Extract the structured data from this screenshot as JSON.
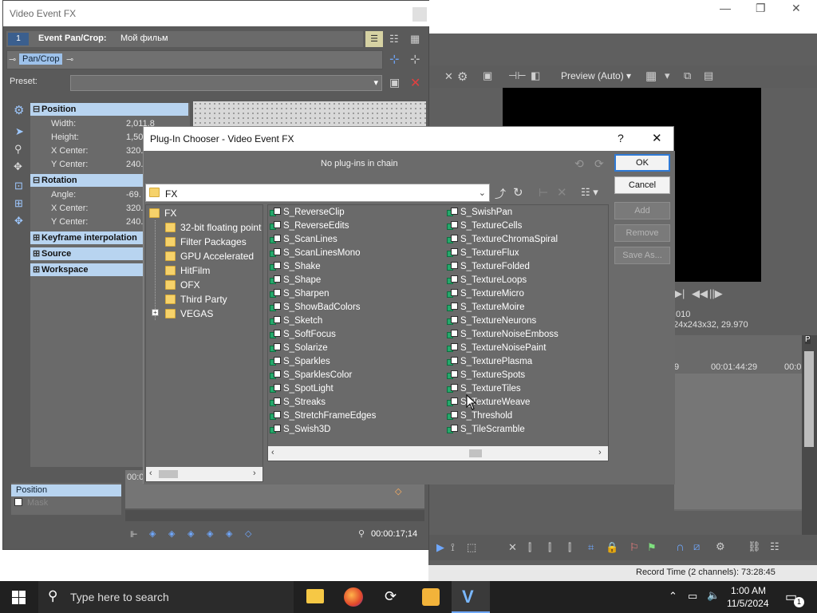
{
  "main_window": {
    "minimize": "—",
    "restore": "❐",
    "close": "✕",
    "preview_mode": "Preview (Auto)",
    "video_info_1": ",010",
    "video_info_2": "24x243x32, 29.970",
    "timecode_1": "9",
    "timecode_2": "00:01:44:29",
    "timecode_3": "00:0",
    "record_time": "Record Time (2 channels): 73:28:45"
  },
  "vfx": {
    "title": "Video Event FX",
    "chain_number": "1",
    "event_label": "Event Pan/Crop:",
    "event_name": "Мой фильм",
    "chain_plugin": "Pan/Crop",
    "preset_label": "Preset:",
    "position_header": "Position",
    "position_rows": [
      {
        "label": "Width:",
        "value": "2,011.8"
      },
      {
        "label": "Height:",
        "value": "1,50"
      },
      {
        "label": "X Center:",
        "value": "320."
      },
      {
        "label": "Y Center:",
        "value": "240."
      }
    ],
    "rotation_header": "Rotation",
    "rotation_rows": [
      {
        "label": "Angle:",
        "value": "-69."
      },
      {
        "label": "X Center:",
        "value": "320."
      },
      {
        "label": "Y Center:",
        "value": "240."
      }
    ],
    "keyframe_header": "Keyframe interpolation",
    "source_header": "Source",
    "workspace_header": "Workspace",
    "track_position": "Position",
    "track_mask": "Mask",
    "timeline_start": "00:0",
    "current_time": "00:00:17;14"
  },
  "dialog": {
    "title": "Plug-In Chooser - Video Event FX",
    "help": "?",
    "close": "✕",
    "chain_status": "No plug-ins in chain",
    "ok": "OK",
    "cancel": "Cancel",
    "add": "Add",
    "remove": "Remove",
    "save_as": "Save As...",
    "path": "FX",
    "tree_root": "FX",
    "tree_items": [
      "32-bit floating point",
      "Filter Packages",
      "GPU Accelerated",
      "HitFilm",
      "OFX",
      "Third Party",
      "VEGAS"
    ],
    "plugins_col1": [
      "S_ReverseClip",
      "S_ReverseEdits",
      "S_ScanLines",
      "S_ScanLinesMono",
      "S_Shake",
      "S_Shape",
      "S_Sharpen",
      "S_ShowBadColors",
      "S_Sketch",
      "S_SoftFocus",
      "S_Solarize",
      "S_Sparkles",
      "S_SparklesColor",
      "S_SpotLight",
      "S_Streaks",
      "S_StretchFrameEdges",
      "S_Swish3D"
    ],
    "plugins_col2": [
      "S_SwishPan",
      "S_TextureCells",
      "S_TextureChromaSpiral",
      "S_TextureFlux",
      "S_TextureFolded",
      "S_TextureLoops",
      "S_TextureMicro",
      "S_TextureMoire",
      "S_TextureNeurons",
      "S_TextureNoiseEmboss",
      "S_TextureNoisePaint",
      "S_TexturePlasma",
      "S_TextureSpots",
      "S_TextureTiles",
      "S_TextureWeave",
      "S_Threshold",
      "S_TileScramble"
    ]
  },
  "taskbar": {
    "search_placeholder": "Type here to search",
    "time": "1:00 AM",
    "date": "11/5/2024",
    "notification_count": "1"
  }
}
